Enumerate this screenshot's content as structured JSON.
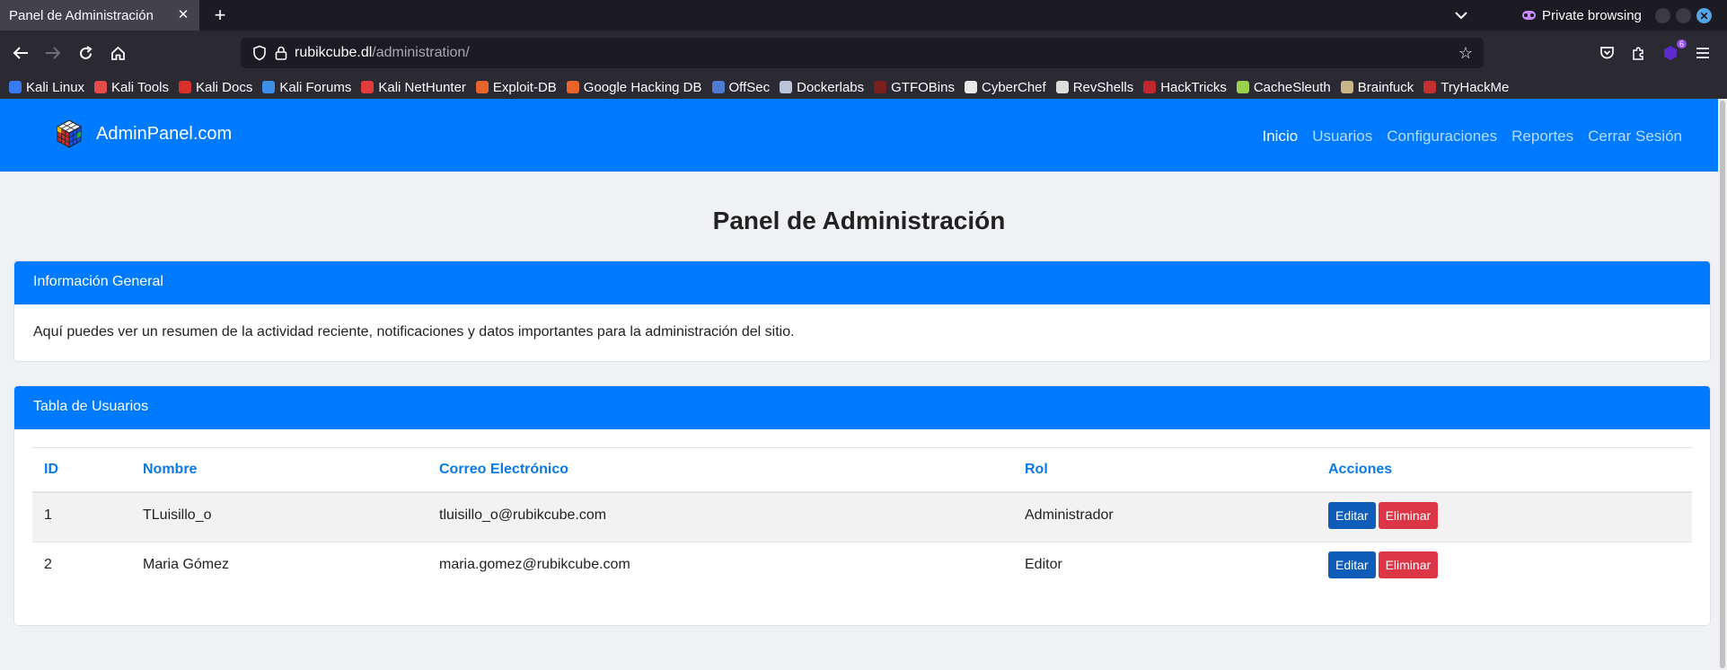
{
  "browser": {
    "tab_title": "Panel de Administración",
    "private_label": "Private browsing",
    "url_domain": "rubikcube.dl",
    "url_path": "/administration/",
    "extension_badge": "6",
    "bookmarks": [
      {
        "label": "Kali Linux",
        "color": "#367bf0"
      },
      {
        "label": "Kali Tools",
        "color": "#e34b4b"
      },
      {
        "label": "Kali Docs",
        "color": "#d9302c"
      },
      {
        "label": "Kali Forums",
        "color": "#3b8fe6"
      },
      {
        "label": "Kali NetHunter",
        "color": "#e03c3c"
      },
      {
        "label": "Exploit-DB",
        "color": "#e8642b"
      },
      {
        "label": "Google Hacking DB",
        "color": "#e8642b"
      },
      {
        "label": "OffSec",
        "color": "#4d7bd1"
      },
      {
        "label": "Dockerlabs",
        "color": "#b9c4d9"
      },
      {
        "label": "GTFOBins",
        "color": "#7a1e1e"
      },
      {
        "label": "CyberChef",
        "color": "#e8e8e8"
      },
      {
        "label": "RevShells",
        "color": "#dcdcdc"
      },
      {
        "label": "HackTricks",
        "color": "#c0282d"
      },
      {
        "label": "CacheSleuth",
        "color": "#9ad04c"
      },
      {
        "label": "Brainfuck",
        "color": "#c7b489"
      },
      {
        "label": "TryHackMe",
        "color": "#c12f2f"
      }
    ]
  },
  "site": {
    "brand": "AdminPanel.com",
    "nav": [
      "Inicio",
      "Usuarios",
      "Configuraciones",
      "Reportes",
      "Cerrar Sesión"
    ],
    "page_title": "Panel de Administración",
    "info_card": {
      "title": "Información General",
      "body": "Aquí puedes ver un resumen de la actividad reciente, notificaciones y datos importantes para la administración del sitio."
    },
    "users_card": {
      "title": "Tabla de Usuarios",
      "columns": [
        "ID",
        "Nombre",
        "Correo Electrónico",
        "Rol",
        "Acciones"
      ],
      "rows": [
        {
          "id": "1",
          "name": "TLuisillo_o",
          "email": "tluisillo_o@rubikcube.com",
          "role": "Administrador"
        },
        {
          "id": "2",
          "name": "Maria Gómez",
          "email": "maria.gomez@rubikcube.com",
          "role": "Editor"
        }
      ],
      "edit_label": "Editar",
      "delete_label": "Eliminar"
    }
  },
  "colors": {
    "primary": "#007bff",
    "danger": "#dc3545",
    "edit": "#0d5db9"
  }
}
